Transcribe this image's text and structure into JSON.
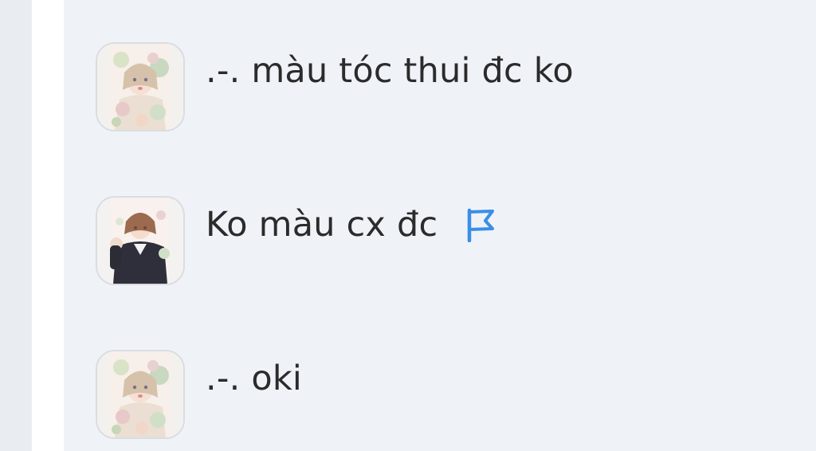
{
  "comments": [
    {
      "text": ".-. màu tóc thui đc ko",
      "avatar": "anime-girl-flowers-avatar"
    },
    {
      "text": "Ko màu cx đc",
      "avatar": "anime-girl-dark-uniform-avatar",
      "flag_icon": "report-flag-icon"
    },
    {
      "text": ".-. oki",
      "avatar": "anime-girl-flowers-avatar"
    }
  ],
  "colors": {
    "background": "#eff3f8",
    "side_strip": "#e9edf2",
    "flag": "#3b8ee6",
    "text": "#2b2b2b"
  }
}
